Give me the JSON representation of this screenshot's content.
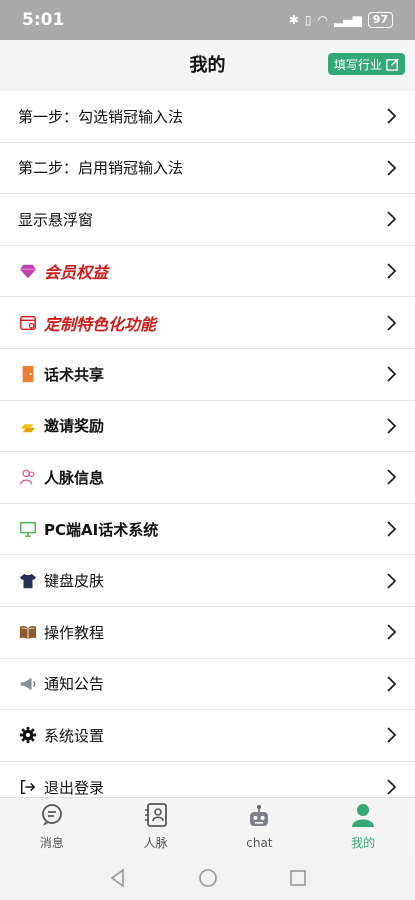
{
  "status": {
    "time": "5:01",
    "battery": "97"
  },
  "header": {
    "title": "我的",
    "fill_button": "填写行业"
  },
  "menu": [
    {
      "label": "第一步：勾选销冠输入法",
      "style": "plain",
      "icon": "none"
    },
    {
      "label": "第二步：启用销冠输入法",
      "style": "plain",
      "icon": "none"
    },
    {
      "label": "显示悬浮窗",
      "style": "plain",
      "icon": "none"
    },
    {
      "label": "会员权益",
      "style": "red-italic",
      "icon": "gem-icon"
    },
    {
      "label": "定制特色化功能",
      "style": "red-italic",
      "icon": "calendar-icon"
    },
    {
      "label": "话术共享",
      "style": "bold",
      "icon": "door-icon"
    },
    {
      "label": "邀请奖励",
      "style": "bold",
      "icon": "gold-icon"
    },
    {
      "label": "人脉信息",
      "style": "bold",
      "icon": "people-icon"
    },
    {
      "label": "PC端AI话术系统",
      "style": "bold",
      "icon": "monitor-icon"
    },
    {
      "label": "键盘皮肤",
      "style": "plain",
      "icon": "shirt-icon"
    },
    {
      "label": "操作教程",
      "style": "plain",
      "icon": "book-icon"
    },
    {
      "label": "通知公告",
      "style": "plain",
      "icon": "megaphone-icon"
    },
    {
      "label": "系统设置",
      "style": "plain",
      "icon": "gear-icon"
    },
    {
      "label": "退出登录",
      "style": "plain",
      "icon": "logout-icon"
    }
  ],
  "nav": [
    {
      "label": "消息",
      "icon": "message-icon",
      "active": false
    },
    {
      "label": "人脉",
      "icon": "contacts-icon",
      "active": false
    },
    {
      "label": "chat",
      "icon": "robot-icon",
      "active": false
    },
    {
      "label": "我的",
      "icon": "user-icon",
      "active": true
    }
  ],
  "colors": {
    "accent": "#35a877",
    "highlight_red": "#d11c1c"
  }
}
